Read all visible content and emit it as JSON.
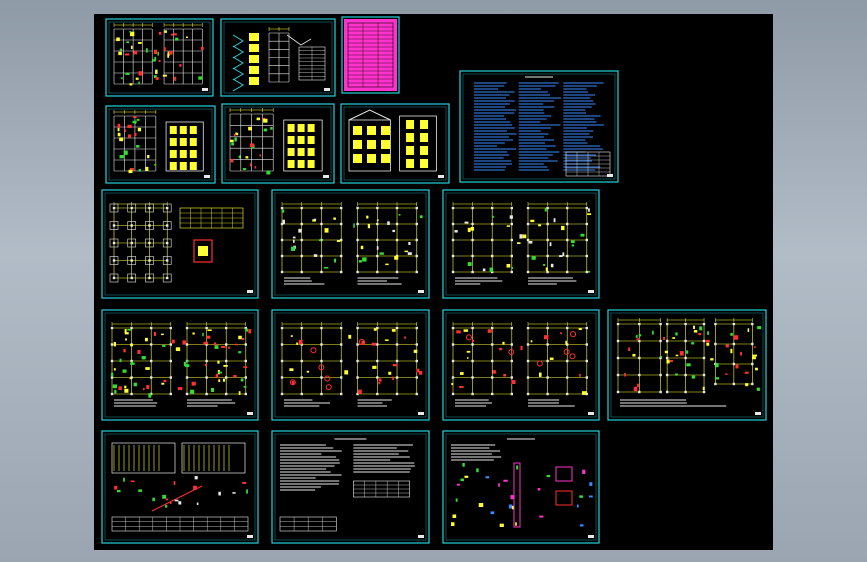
{
  "colors": {
    "background_gradient": [
      "#8f9aa7",
      "#b2bcc7"
    ],
    "canvas": "#000000",
    "frame": "#22d3dd",
    "line_yellow": "#ffff33",
    "line_white": "#e8e8e8",
    "line_green": "#33dd33",
    "line_red": "#ff3030",
    "line_magenta": "#ff33cc",
    "notes_blue": "#3a8cff"
  },
  "sheets": [
    {
      "id": "s1",
      "kind": "plans_color"
    },
    {
      "id": "s2",
      "kind": "stair_section"
    },
    {
      "id": "s3",
      "kind": "magenta_table"
    },
    {
      "id": "s4",
      "kind": "notes_blue"
    },
    {
      "id": "s5",
      "kind": "plan_elevation"
    },
    {
      "id": "s6",
      "kind": "plan_elevation"
    },
    {
      "id": "s7",
      "kind": "elevations"
    },
    {
      "id": "s8",
      "kind": "foundation"
    },
    {
      "id": "s9",
      "kind": "structural_plans"
    },
    {
      "id": "s10",
      "kind": "structural_plans"
    },
    {
      "id": "s11",
      "kind": "rebar_plans"
    },
    {
      "id": "s12",
      "kind": "beam_plans"
    },
    {
      "id": "s13",
      "kind": "beam_plans"
    },
    {
      "id": "s14",
      "kind": "detail_plans"
    },
    {
      "id": "s15",
      "kind": "stair_details"
    },
    {
      "id": "s16",
      "kind": "structural_notes"
    },
    {
      "id": "s17",
      "kind": "section_details"
    }
  ]
}
